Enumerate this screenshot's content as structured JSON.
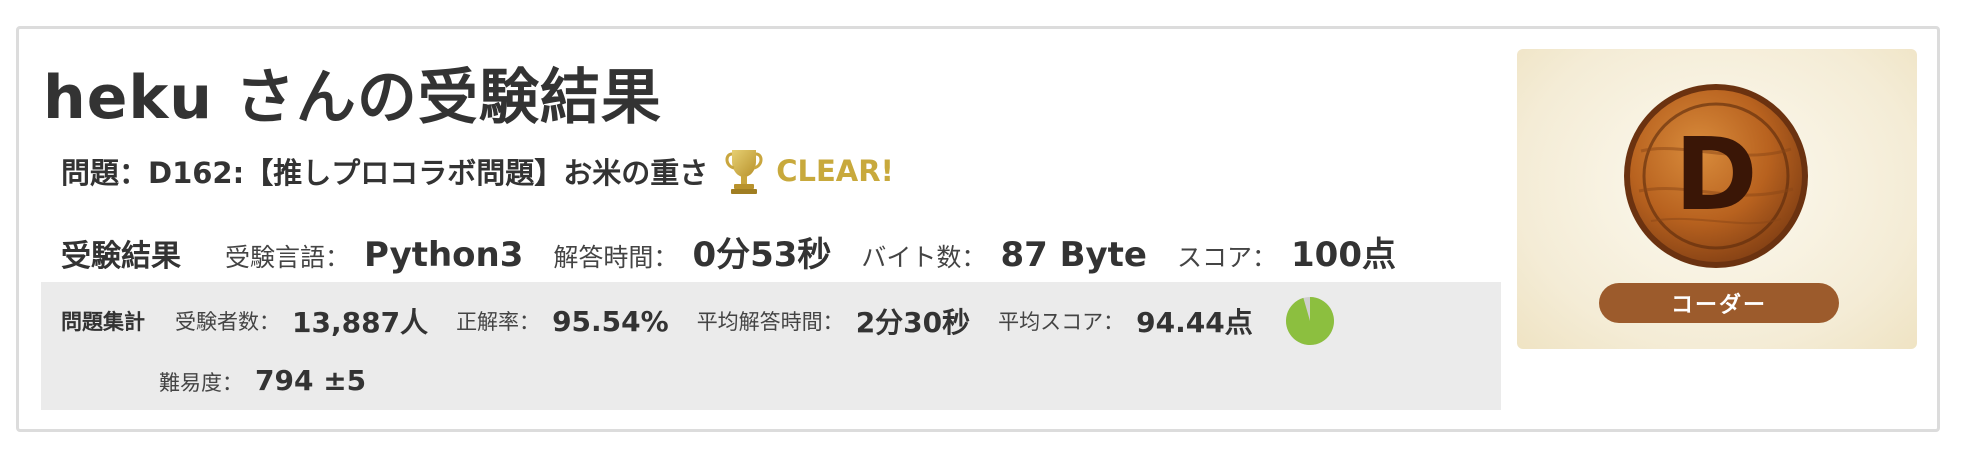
{
  "title": "heku さんの受験結果",
  "problem": {
    "text": "問題：D162:【推しプロコラボ問題】お米の重さ",
    "status": "CLEAR!",
    "trophy_icon": "trophy-icon",
    "status_color": "#c8a93c"
  },
  "result": {
    "section_label": "受験結果",
    "language_label": "受験言語：",
    "language_value": "Python3",
    "time_label": "解答時間：",
    "time_value": "0分53秒",
    "bytes_label": "バイト数：",
    "bytes_value": "87 Byte",
    "score_label": "スコア：",
    "score_value": "100点"
  },
  "summary": {
    "section_label": "問題集計",
    "examinees_label": "受験者数：",
    "examinees_value": "13,887人",
    "accuracy_label": "正解率：",
    "accuracy_value": "95.54%",
    "accuracy_fraction": 0.9554,
    "avg_time_label": "平均解答時間：",
    "avg_time_value": "2分30秒",
    "avg_score_label": "平均スコア：",
    "avg_score_value": "94.44点",
    "difficulty_label": "難易度：",
    "difficulty_value": "794 ±5",
    "pie_color": "#8cbf3f"
  },
  "rank": {
    "letter": "D",
    "title": "コーダー",
    "pill_color": "#9c5b2c"
  }
}
